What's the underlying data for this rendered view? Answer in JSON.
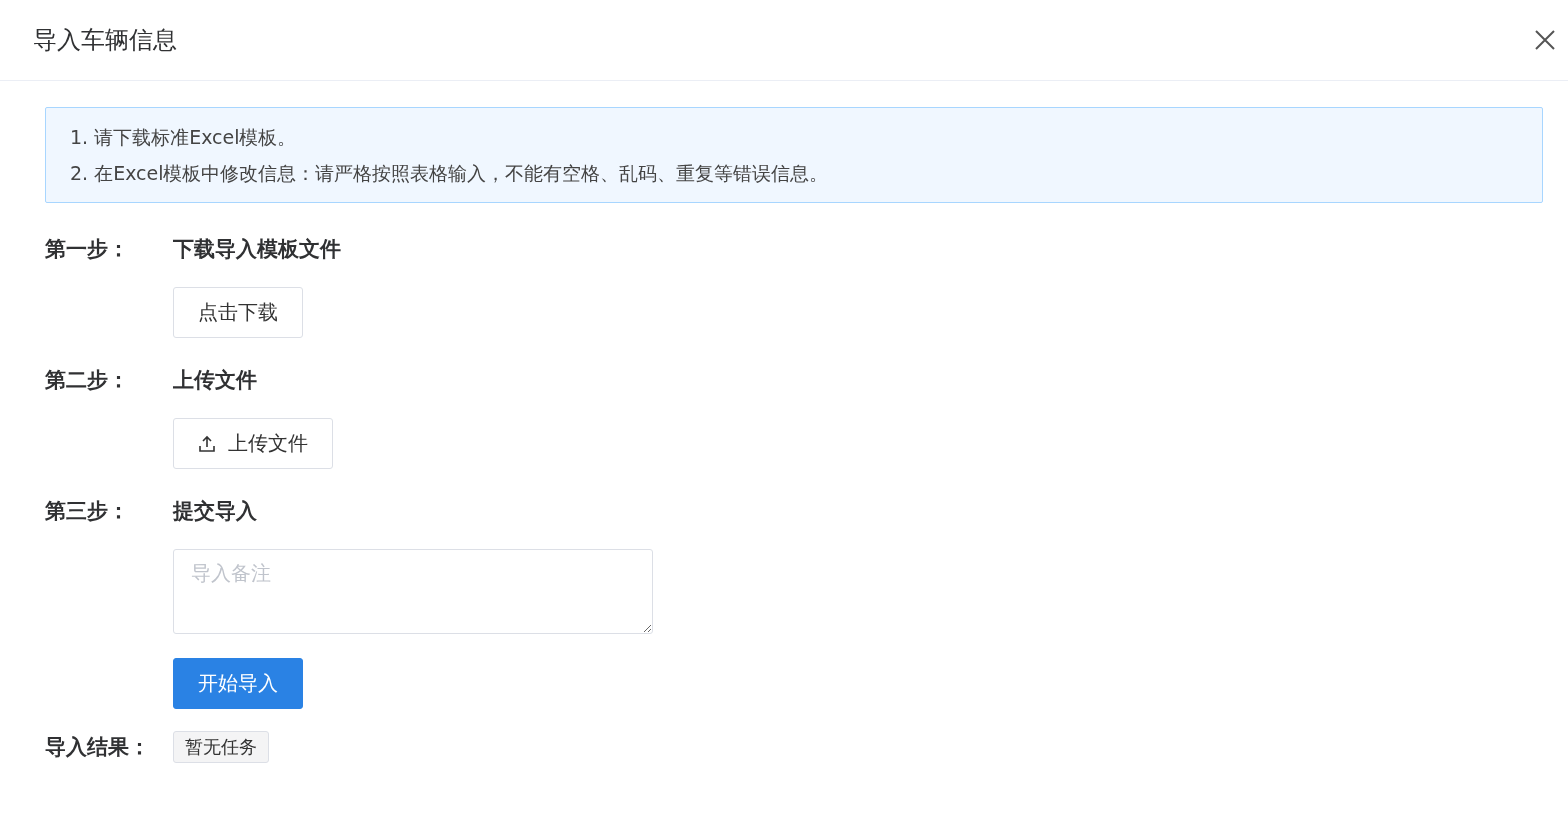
{
  "dialog": {
    "title": "导入车辆信息"
  },
  "notice": [
    "1. 请下载标准Excel模板。",
    "2. 在Excel模板中修改信息：请严格按照表格输入，不能有空格、乱码、重复等错误信息。"
  ],
  "steps": [
    {
      "label": "第一步：",
      "title": "下载导入模板文件",
      "kind": "download",
      "button": "点击下载"
    },
    {
      "label": "第二步：",
      "title": "上传文件",
      "kind": "upload",
      "button": "上传文件"
    },
    {
      "label": "第三步：",
      "title": "提交导入",
      "kind": "submit",
      "placeholder": "导入备注",
      "button": "开始导入"
    }
  ],
  "result": {
    "label": "导入结果：",
    "tag": "暂无任务"
  }
}
